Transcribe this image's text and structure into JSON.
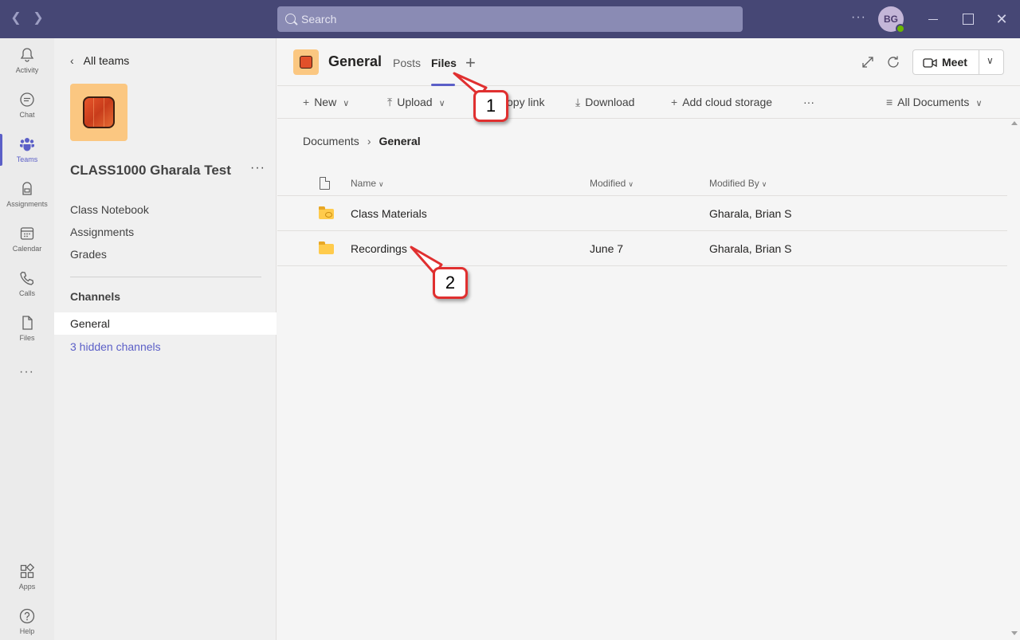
{
  "titlebar": {
    "search_placeholder": "Search",
    "avatar_initials": "BG",
    "more": "···"
  },
  "rail": [
    {
      "label": "Activity",
      "icon": "bell-icon"
    },
    {
      "label": "Chat",
      "icon": "chat-icon"
    },
    {
      "label": "Teams",
      "icon": "teams-icon",
      "active": true
    },
    {
      "label": "Assignments",
      "icon": "assignments-icon"
    },
    {
      "label": "Calendar",
      "icon": "calendar-icon"
    },
    {
      "label": "Calls",
      "icon": "phone-icon"
    },
    {
      "label": "Files",
      "icon": "file-icon"
    },
    {
      "label": "Apps",
      "icon": "apps-icon"
    },
    {
      "label": "Help",
      "icon": "help-icon"
    }
  ],
  "rail_more": "···",
  "team_panel": {
    "back_label": "All teams",
    "team_name": "CLASS1000 Gharala Test",
    "more": "···",
    "links": [
      "Class Notebook",
      "Assignments",
      "Grades"
    ],
    "channels_heading": "Channels",
    "selected_channel": "General",
    "hidden_channels": "3 hidden channels"
  },
  "header": {
    "channel_title": "General",
    "tabs": [
      "Posts",
      "Files"
    ],
    "active_tab": "Files",
    "add_tab": "+",
    "meet_label": "Meet"
  },
  "toolbar": {
    "new": "New",
    "upload": "Upload",
    "copy_link": "opy link",
    "download": "Download",
    "add_cloud": "Add cloud storage",
    "more": "···",
    "view": "All Documents"
  },
  "breadcrumb": {
    "root": "Documents",
    "current": "General"
  },
  "table": {
    "columns": [
      "Name",
      "Modified",
      "Modified By"
    ],
    "rows": [
      {
        "name": "Class Materials",
        "modified": "",
        "modified_by": "Gharala, Brian S",
        "type": "shared-folder"
      },
      {
        "name": "Recordings",
        "modified": "June 7",
        "modified_by": "Gharala, Brian S",
        "type": "folder"
      }
    ]
  },
  "callouts": [
    "1",
    "2"
  ],
  "colors": {
    "titlebar": "#464775",
    "accent": "#5b5fc7",
    "callout_border": "#e03030",
    "folder": "#ffcb4c"
  }
}
